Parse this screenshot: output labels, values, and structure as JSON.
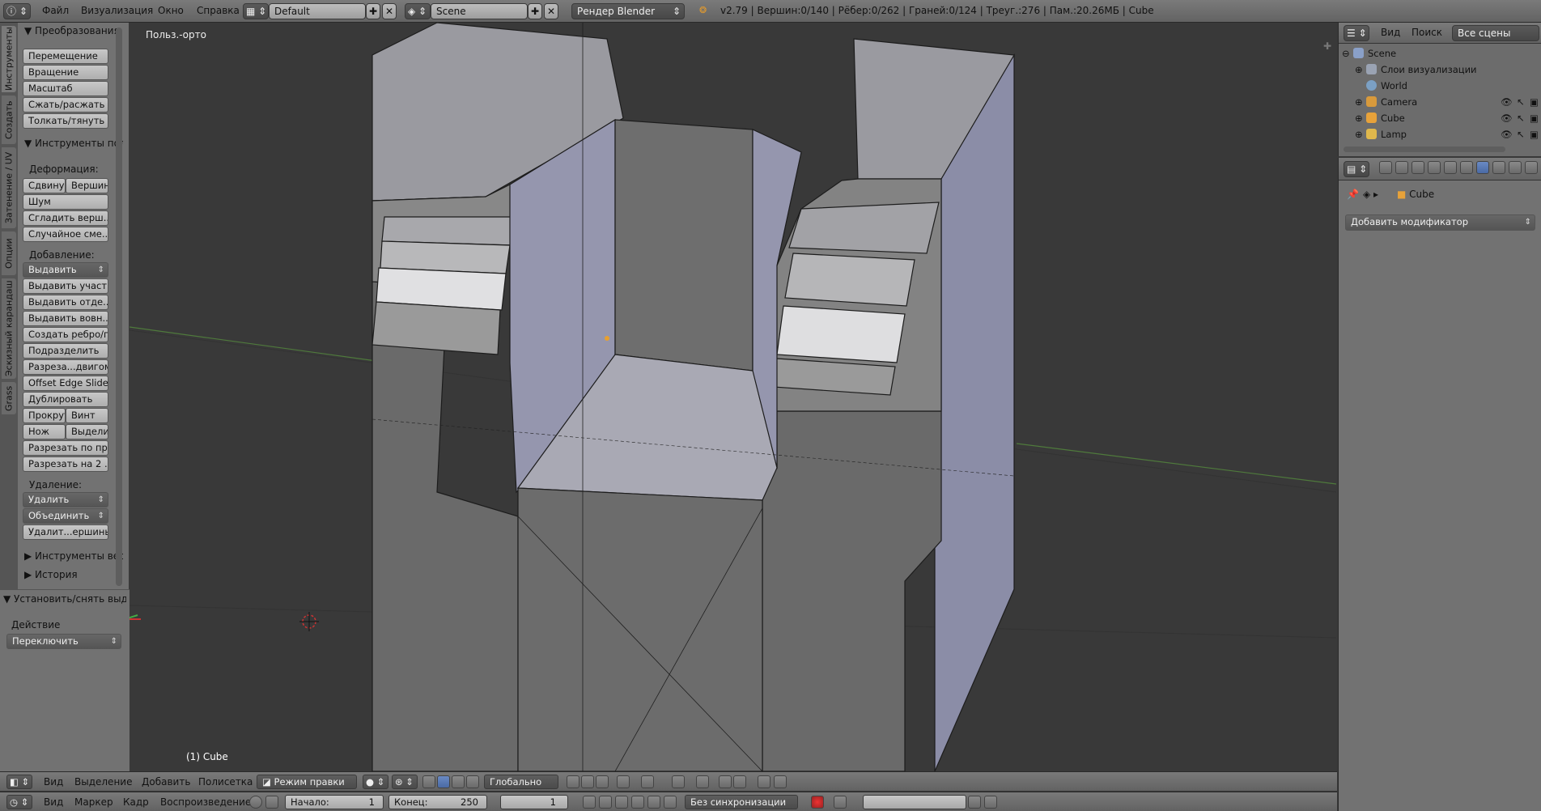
{
  "menu": {
    "file": "Файл",
    "render": "Визуализация",
    "window": "Окно",
    "help": "Справка"
  },
  "layout": "Default",
  "scene": "Scene",
  "engine": "Рендер Blender",
  "stats": "v2.79 | Вершин:0/140 | Рёбер:0/262 | Граней:0/124 | Треуг.:276 | Пам.:20.26МБ | Cube",
  "vtabs": [
    "Инструменты",
    "Создать",
    "Затенение / UV",
    "Опции",
    "Эскизный карандаш",
    "Grass"
  ],
  "tools": {
    "transform_header": "Преобразования",
    "transform": [
      "Перемещение",
      "Вращение",
      "Масштаб",
      "Сжать/раcжать",
      "Толкать/тянуть"
    ],
    "mesh_header": "Инструменты полисетки",
    "deform_label": "Деформация:",
    "deform_row": [
      "Сдвину",
      "Вершин"
    ],
    "deform": [
      "Шум",
      "Сгладить верш...",
      "Случайное сме..."
    ],
    "add_label": "Добавление:",
    "extrude": "Выдавить",
    "add": [
      "Выдавить участ...",
      "Выдавить отде...",
      "Выдавить вовн...",
      "Создать ребро/г...",
      "Подразделить",
      "Разреза...двигом",
      "Offset Edge Slide",
      "Дублировать"
    ],
    "row_spin": [
      "Прокрут",
      "Винт"
    ],
    "row_knife": [
      "Нож",
      "Выдели"
    ],
    "add2": [
      "Разрезать по пр...",
      "Разрезать на 2 ..."
    ],
    "remove_label": "Удаление:",
    "remove_dd": [
      "Удалить",
      "Объединить"
    ],
    "remove": [
      "Удалит...ершины"
    ],
    "weights_header": "Инструменты весов",
    "history_header": "История",
    "operator_header": "Установить/снять выделение",
    "action_label": "Действие",
    "action_value": "Переключить"
  },
  "viewport": {
    "view_label": "Польз.-орто",
    "object_label": "(1) Cube"
  },
  "outliner": {
    "view": "Вид",
    "search": "Поиск",
    "filter": "Все сцены",
    "items": [
      {
        "name": "Scene",
        "color": "#8aa0c8"
      },
      {
        "name": "Слои визуализации",
        "color": "#9aa3b3"
      },
      {
        "name": "World",
        "color": "#7ba0c4"
      },
      {
        "name": "Camera",
        "color": "#d89a3c"
      },
      {
        "name": "Cube",
        "color": "#e7a23a"
      },
      {
        "name": "Lamp",
        "color": "#e0b84c"
      }
    ]
  },
  "properties": {
    "object": "Cube",
    "add_modifier": "Добавить модификатор"
  },
  "view3d_header": {
    "view": "Вид",
    "select": "Выделение",
    "add": "Добавить",
    "mesh": "Полисетка",
    "mode": "Режим правки",
    "orientation": "Глобально"
  },
  "timeline": {
    "view": "Вид",
    "marker": "Маркер",
    "frame": "Кадр",
    "playback": "Воспроизведение",
    "start_label": "Начало:",
    "start": "1",
    "end_label": "Конец:",
    "end": "250",
    "current": "1",
    "sync": "Без синхронизации"
  }
}
